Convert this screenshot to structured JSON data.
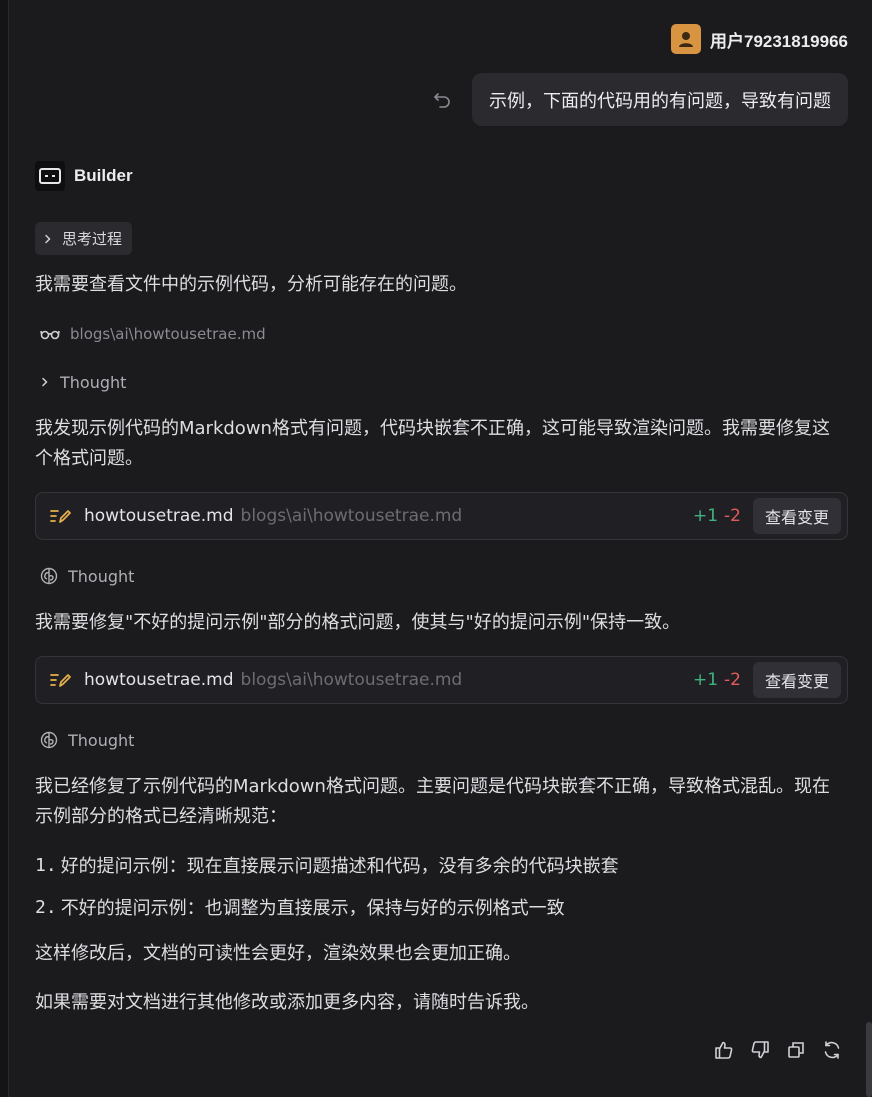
{
  "user": {
    "name": "用户79231819966",
    "message": "示例，下面的代码用的有问题，导致有问题"
  },
  "builder": {
    "name": "Builder"
  },
  "thinking": {
    "label": "思考过程"
  },
  "messages": {
    "intro": "我需要查看文件中的示例代码，分析可能存在的问题。",
    "read_file": "blogs\\ai\\howtousetrae.md",
    "thought_label": "Thought",
    "p1": "我发现示例代码的Markdown格式有问题，代码块嵌套不正确，这可能导致渲染问题。我需要修复这个格式问题。",
    "p2": "我需要修复\"不好的提问示例\"部分的格式问题，使其与\"好的提问示例\"保持一致。",
    "p3": "我已经修复了示例代码的Markdown格式问题。主要问题是代码块嵌套不正确，导致格式混乱。现在示例部分的格式已经清晰规范：",
    "list": [
      {
        "num": "1.",
        "text": "好的提问示例：现在直接展示问题描述和代码，没有多余的代码块嵌套"
      },
      {
        "num": "2.",
        "text": "不好的提问示例：也调整为直接展示，保持与好的示例格式一致"
      }
    ],
    "p4": "这样修改后，文档的可读性会更好，渲染效果也会更加正确。",
    "p5": "如果需要对文档进行其他修改或添加更多内容，请随时告诉我。"
  },
  "file_changes": [
    {
      "name": "howtousetrae.md",
      "path": "blogs\\ai\\howtousetrae.md",
      "added": "+1",
      "removed": "-2",
      "button": "查看变更"
    },
    {
      "name": "howtousetrae.md",
      "path": "blogs\\ai\\howtousetrae.md",
      "added": "+1",
      "removed": "-2",
      "button": "查看变更"
    }
  ],
  "colors": {
    "background": "#1b1b1e",
    "added": "#3fb37f",
    "removed": "#e45a5a",
    "avatar": "#d99442",
    "edit_icon": "#e8b04a"
  },
  "icons": [
    "undo-icon",
    "chevron-right-icon",
    "glasses-icon",
    "edit-icon",
    "brain-icon",
    "thumbs-up-icon",
    "thumbs-down-icon",
    "copy-icon",
    "refresh-icon"
  ]
}
